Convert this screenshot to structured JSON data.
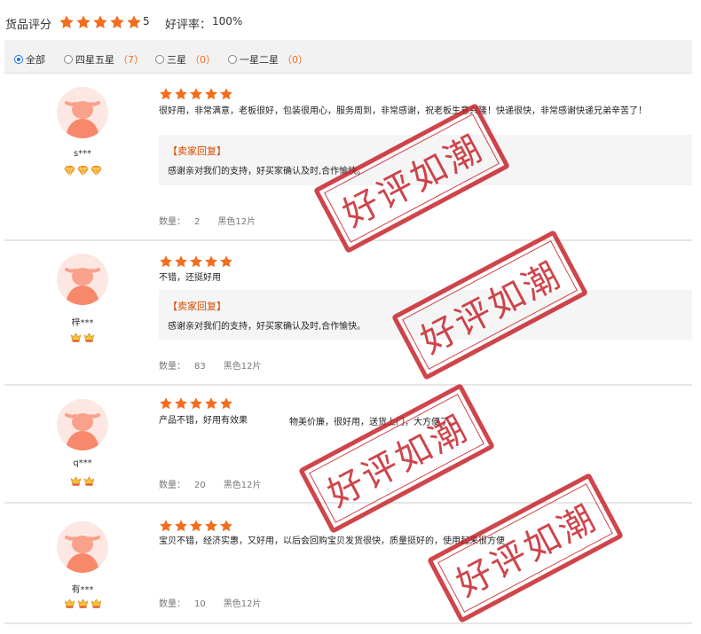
{
  "summary": {
    "score_label": "货品评分",
    "score_value": "5",
    "good_rate_label": "好评率：",
    "good_rate_value": "100%",
    "star_color": "#f26d1d"
  },
  "filters": [
    {
      "label": "全部",
      "count": "",
      "selected": true
    },
    {
      "label": "四星五星",
      "count": "（7）",
      "selected": false
    },
    {
      "label": "三星",
      "count": "（0）",
      "selected": false
    },
    {
      "label": "一星二星",
      "count": "（0）",
      "selected": false
    }
  ],
  "reply_title": "【卖家回复】",
  "quantity_label": "数量：",
  "stamp_text": "好评如潮",
  "reviews": [
    {
      "username": "s***",
      "badge_type": "diamond",
      "badge_count": 3,
      "rating": 5,
      "text": "很好用，非常满意，老板很好，包装很用心，服务周到，非常感谢，祝老板生意兴隆！快递很快，非常感谢快递兄弟辛苦了！",
      "reply": "感谢亲对我们的支持，好买家确认及时,合作愉快。",
      "quantity": "2",
      "spec": "黑色12片"
    },
    {
      "username": "梓***",
      "badge_type": "crown",
      "badge_count": 2,
      "rating": 5,
      "text": "不错，还挺好用",
      "reply": "感谢亲对我们的支持，好买家确认及时,合作愉快。",
      "quantity": "83",
      "spec": "黑色12片"
    },
    {
      "username": "q***",
      "badge_type": "crown",
      "badge_count": 2,
      "rating": 5,
      "text": "产品不错，好用有效果",
      "text2": "物美价廉，很好用，送货上门，大方便了。",
      "quantity": "20",
      "spec": "黑色12片"
    },
    {
      "username": "有***",
      "badge_type": "crown",
      "badge_count": 3,
      "rating": 5,
      "text": "宝贝不错，经济实惠，又好用，以后会回购宝贝发货很快，质量挺好的，使用起来很方便",
      "quantity": "10",
      "spec": "黑色12片"
    }
  ]
}
